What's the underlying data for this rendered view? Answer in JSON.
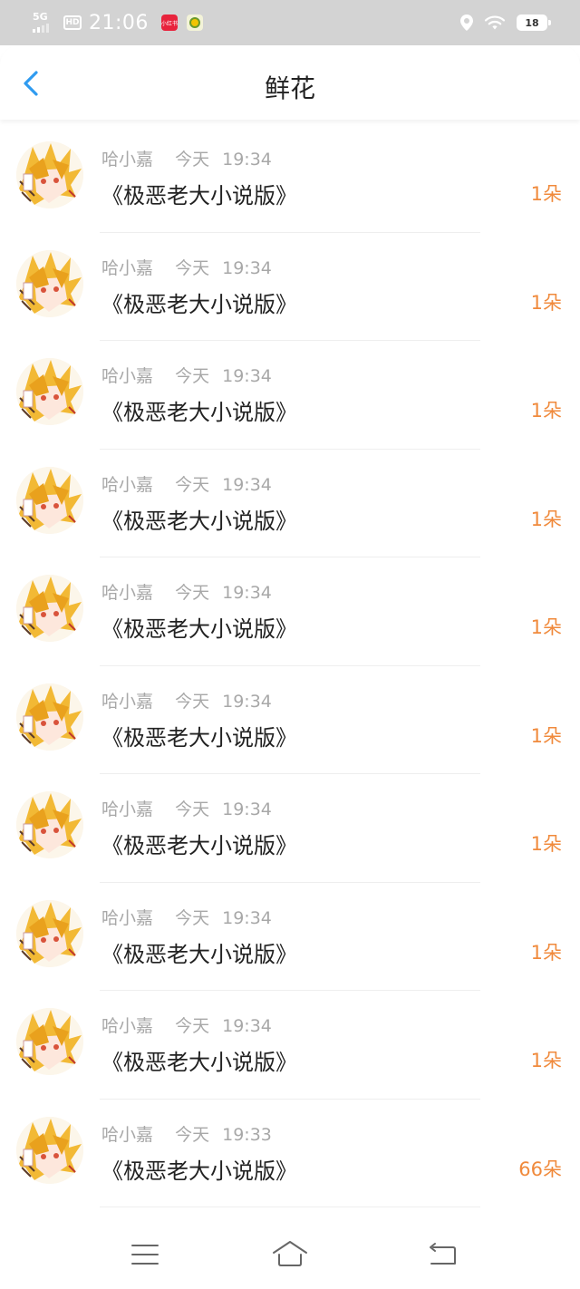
{
  "status_bar": {
    "network": "5G",
    "hd_badge": "HD",
    "time": "21:06",
    "app1_label": "小红书",
    "battery": "18"
  },
  "header": {
    "title": "鲜花"
  },
  "list": [
    {
      "user": "哈小嘉",
      "day": "今天",
      "time": "19:34",
      "book": "《极恶老大小说版》",
      "count": "1朵"
    },
    {
      "user": "哈小嘉",
      "day": "今天",
      "time": "19:34",
      "book": "《极恶老大小说版》",
      "count": "1朵"
    },
    {
      "user": "哈小嘉",
      "day": "今天",
      "time": "19:34",
      "book": "《极恶老大小说版》",
      "count": "1朵"
    },
    {
      "user": "哈小嘉",
      "day": "今天",
      "time": "19:34",
      "book": "《极恶老大小说版》",
      "count": "1朵"
    },
    {
      "user": "哈小嘉",
      "day": "今天",
      "time": "19:34",
      "book": "《极恶老大小说版》",
      "count": "1朵"
    },
    {
      "user": "哈小嘉",
      "day": "今天",
      "time": "19:34",
      "book": "《极恶老大小说版》",
      "count": "1朵"
    },
    {
      "user": "哈小嘉",
      "day": "今天",
      "time": "19:34",
      "book": "《极恶老大小说版》",
      "count": "1朵"
    },
    {
      "user": "哈小嘉",
      "day": "今天",
      "time": "19:34",
      "book": "《极恶老大小说版》",
      "count": "1朵"
    },
    {
      "user": "哈小嘉",
      "day": "今天",
      "time": "19:34",
      "book": "《极恶老大小说版》",
      "count": "1朵"
    },
    {
      "user": "哈小嘉",
      "day": "今天",
      "time": "19:33",
      "book": "《极恶老大小说版》",
      "count": "66朵"
    }
  ],
  "colors": {
    "accent_blue": "#2f9bf0",
    "count_orange": "#f08a3c",
    "meta_gray": "#a8a8a8",
    "status_bar_bg": "#d3d3d3"
  },
  "icons": {
    "back": "chevron-left-icon",
    "menu": "menu-icon",
    "home": "home-icon",
    "return": "return-icon"
  }
}
